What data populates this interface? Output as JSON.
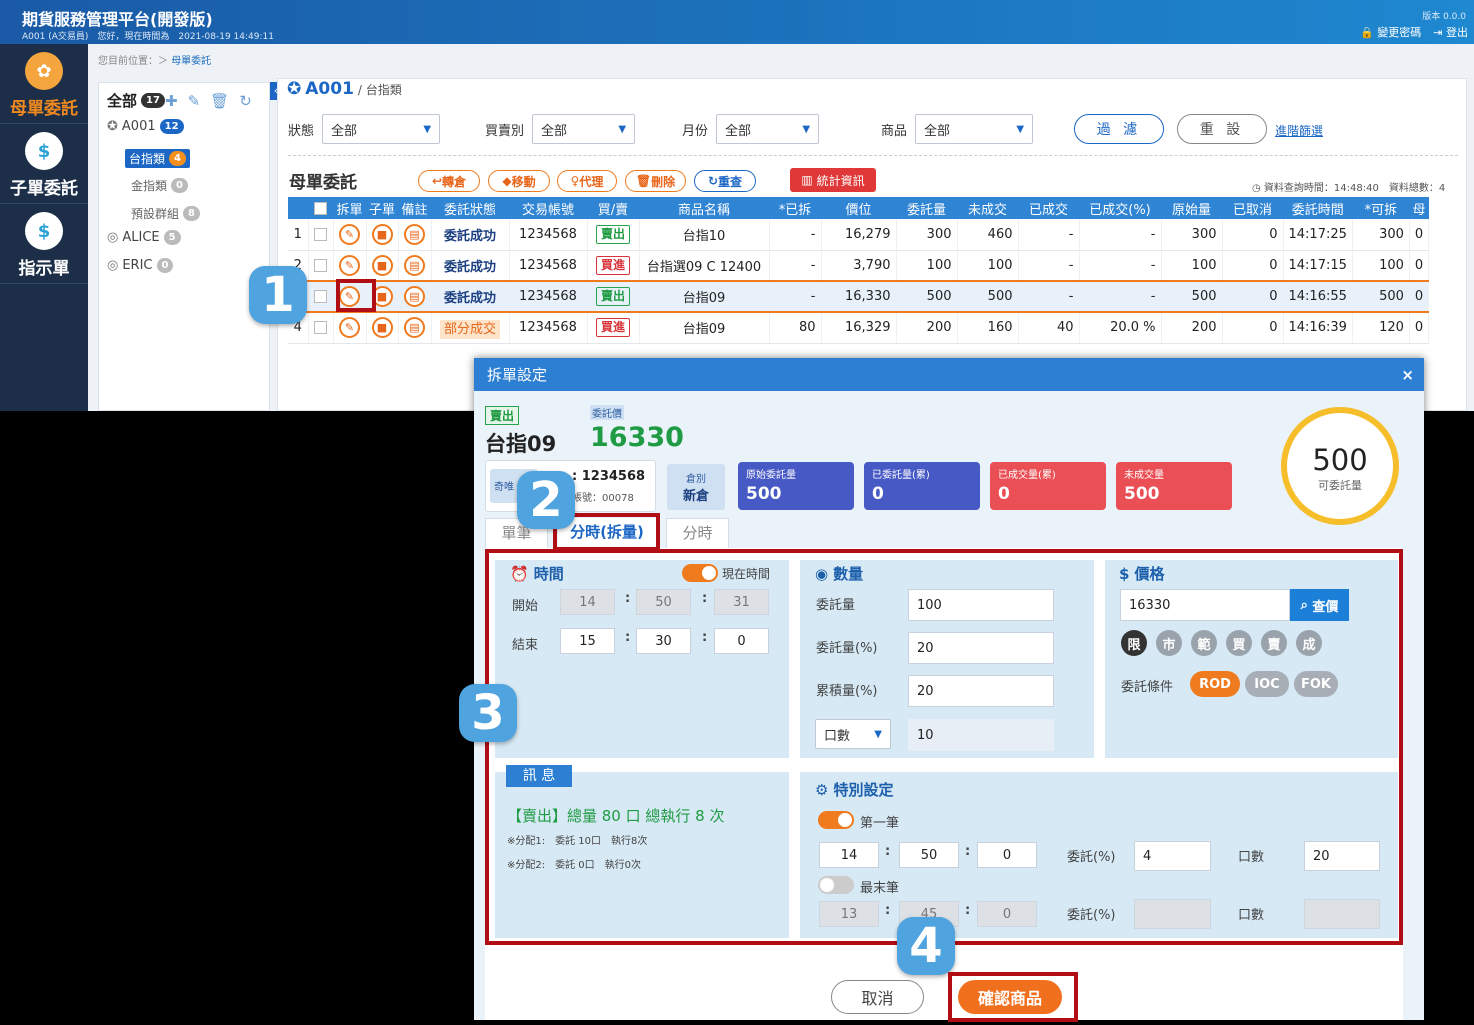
{
  "app": {
    "title": "期貨服務管理平台(開發版)",
    "user_line": "A001 (A交易員)　您好，現在時間為　2021-08-19 14:49:11",
    "version": "版本 0.0.0",
    "change_pwd": "變更密碼",
    "logout": "登出"
  },
  "nav": [
    {
      "label": "母單委託",
      "icon": "tree-icon"
    },
    {
      "label": "子單委託",
      "icon": "hands-coin-icon"
    },
    {
      "label": "指示單",
      "icon": "bulb-icon"
    }
  ],
  "breadcrumb": {
    "prefix": "您目前位置：＞",
    "current": "母單委託"
  },
  "tree": {
    "all_label": "全部",
    "all_count": "17",
    "a001": "A001",
    "a001_count": "12",
    "g1": "台指類",
    "g1_count": "4",
    "g2": "金指類",
    "g2_count": "0",
    "g3": "預設群組",
    "g3_count": "8",
    "alice": "ALICE",
    "alice_count": "5",
    "eric": "ERIC",
    "eric_count": "0"
  },
  "content": {
    "account": "A001",
    "category": "/ 台指類"
  },
  "filters": {
    "status_label": "狀態",
    "status_val": "全部",
    "side_label": "買賣別",
    "side_val": "全部",
    "month_label": "月份",
    "month_val": "全部",
    "product_label": "商品",
    "product_val": "全部",
    "filter_btn": "過 濾",
    "reset_btn": "重 設",
    "advanced": "進階篩選"
  },
  "orders": {
    "title": "母單委託",
    "btn_transfer": "轉倉",
    "btn_move": "移動",
    "btn_proxy": "代理",
    "btn_delete": "刪除",
    "btn_requery": "重查",
    "btn_stats": "統計資訊",
    "query_time": "資料查詢時間：14:48:40　資料總數：4",
    "columns": [
      "",
      "拆單",
      "子單",
      "備註",
      "委託狀態",
      "交易帳號",
      "買/賣",
      "商品名稱",
      "*已拆",
      "價位",
      "委託量",
      "未成交",
      "已成交",
      "已成交(%)",
      "原始量",
      "已取消",
      "委託時間",
      "*可拆",
      "母"
    ],
    "rows": [
      {
        "no": "1",
        "status": "委託成功",
        "account": "1234568",
        "side": "賣出",
        "product": "台指10",
        "split": "-",
        "price": "16,279",
        "qty": "300",
        "unfilled": "460",
        "filled": "-",
        "filled_pct": "-",
        "orig": "300",
        "cancel": "0",
        "time": "14:17:25",
        "avail": "300",
        "m": "0"
      },
      {
        "no": "2",
        "status": "委託成功",
        "account": "1234568",
        "side": "買進",
        "product": "台指選09 C 12400",
        "split": "-",
        "price": "3,790",
        "qty": "100",
        "unfilled": "100",
        "filled": "-",
        "filled_pct": "-",
        "orig": "100",
        "cancel": "0",
        "time": "14:17:15",
        "avail": "100",
        "m": "0"
      },
      {
        "no": "3",
        "status": "委託成功",
        "account": "1234568",
        "side": "賣出",
        "product": "台指09",
        "split": "-",
        "price": "16,330",
        "qty": "500",
        "unfilled": "500",
        "filled": "-",
        "filled_pct": "-",
        "orig": "500",
        "cancel": "0",
        "time": "14:16:55",
        "avail": "500",
        "m": "0"
      },
      {
        "no": "4",
        "status": "部分成交",
        "account": "1234568",
        "side": "買進",
        "product": "台指09",
        "split": "80",
        "price": "16,329",
        "qty": "200",
        "unfilled": "160",
        "filled": "40",
        "filled_pct": "20.0 %",
        "orig": "200",
        "cancel": "0",
        "time": "14:16:39",
        "avail": "120",
        "m": "0"
      }
    ]
  },
  "steps": [
    "1",
    "2",
    "3",
    "4"
  ],
  "modal": {
    "title": "拆單設定",
    "close": "×",
    "side": "賣出",
    "price_label": "委託價",
    "product": "台指09",
    "price": "16330",
    "acct_tag": "奇唯",
    "acct_no": ": 1234568",
    "acct_sub": "帳號：00078",
    "pos_label": "倉別",
    "pos_val": "新倉",
    "stats": [
      {
        "label": "原始委託量",
        "value": "500",
        "color": "#3c5cc0"
      },
      {
        "label": "已委託量(累)",
        "value": "0",
        "color": "#3c5cc0"
      },
      {
        "label": "已成交量(累)",
        "value": "0",
        "color": "#ea4f55"
      },
      {
        "label": "未成交量",
        "value": "500",
        "color": "#ea4f55"
      }
    ],
    "ring_value": "500",
    "ring_label": "可委託量",
    "tabs": [
      "單筆",
      "分時(拆量)",
      "分時"
    ],
    "time": {
      "title": "時間",
      "now_label": "現在時間",
      "start_label": "開始",
      "end_label": "結束",
      "start": [
        "14",
        "50",
        "31"
      ],
      "end": [
        "15",
        "30",
        "0"
      ]
    },
    "qty": {
      "title": "數量",
      "qty_label": "委託量",
      "qty_val": "100",
      "pct_label": "委託量(%)",
      "pct_val": "20",
      "cum_label": "累積量(%)",
      "cum_val": "20",
      "unit_sel": "口數",
      "unit_val": "10"
    },
    "price_panel": {
      "title": "價格",
      "price_val": "16330",
      "query_btn": "查價",
      "types": [
        "限",
        "市",
        "範",
        "買",
        "賣",
        "成"
      ],
      "cond_label": "委託條件",
      "conds": [
        "ROD",
        "IOC",
        "FOK"
      ]
    },
    "msg": {
      "title": "訊 息",
      "summary": "【賣出】總量 80 口 總執行 8 次",
      "line1": "※分配1:　委託 10口　執行8次",
      "line2": "※分配2:　委託 0口　執行0次"
    },
    "special": {
      "title": "特別設定",
      "first_label": "第一筆",
      "first_time": [
        "14",
        "50",
        "0"
      ],
      "first_pct_label": "委託(%)",
      "first_pct": "4",
      "first_lots_label": "口數",
      "first_lots": "20",
      "last_label": "最末筆",
      "last_time": [
        "13",
        "45",
        "0"
      ],
      "last_pct_label": "委託(%)",
      "last_lots_label": "口數"
    },
    "cancel_btn": "取消",
    "confirm_btn": "確認商品"
  }
}
